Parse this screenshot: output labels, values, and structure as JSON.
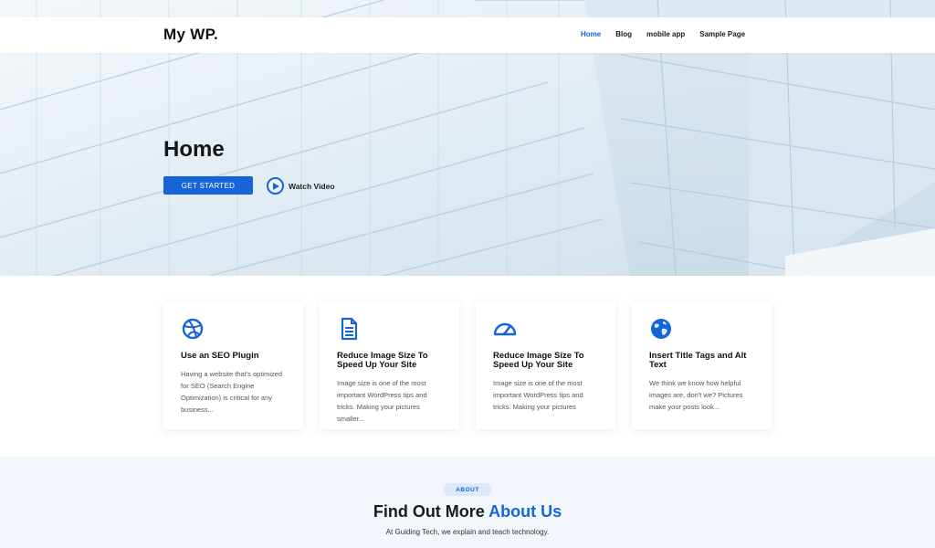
{
  "header": {
    "logo": "My WP.",
    "nav": [
      "Home",
      "Blog",
      "mobile app",
      "Sample Page"
    ],
    "active_index": 0
  },
  "hero": {
    "title": "Home",
    "cta_label": "GET STARTED",
    "video_label": "Watch Video"
  },
  "cards": [
    {
      "icon": "dribbble-icon",
      "title": "Use an SEO Plugin",
      "text": "Having a website that's optimized for SEO (Search Engine Optimization) is critical for any business..."
    },
    {
      "icon": "document-icon",
      "title": "Reduce Image Size To Speed Up Your Site",
      "text": "Image size is one of the most important WordPress tips and tricks. Making your pictures smaller..."
    },
    {
      "icon": "speedometer-icon",
      "title": "Reduce Image Size To Speed Up Your Site",
      "text": "Image size is one of the most important WordPress tips and tricks. Making your pictures"
    },
    {
      "icon": "globe-icon",
      "title": "Insert Title Tags and Alt Text",
      "text": "We think we know how helpful images are, don't we? Pictures make your posts look..."
    }
  ],
  "about": {
    "pill": "ABOUT",
    "heading": "Find Out More",
    "heading_accent": "About Us",
    "subtitle": "At Guiding Tech, we explain and teach technology."
  },
  "colors": {
    "accent": "#1565d8",
    "about_bg": "#f2f7fd"
  }
}
